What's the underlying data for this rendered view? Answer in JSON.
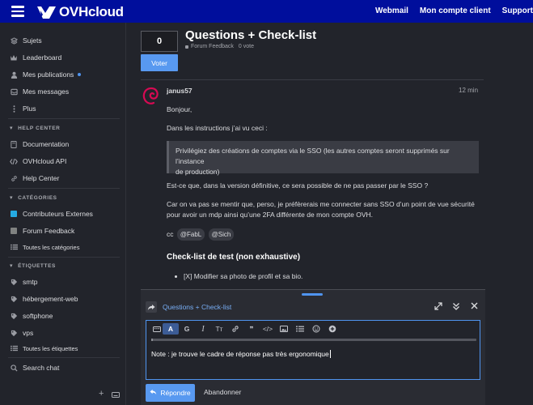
{
  "header": {
    "brand": "OVHcloud",
    "nav": [
      "Webmail",
      "Mon compte client",
      "Support"
    ]
  },
  "sidebar": {
    "main": [
      {
        "label": "Sujets",
        "icon": "layers-icon"
      },
      {
        "label": "Leaderboard",
        "icon": "crown-icon"
      },
      {
        "label": "Mes publications",
        "icon": "user-icon",
        "badge": true
      },
      {
        "label": "Mes messages",
        "icon": "inbox-icon"
      },
      {
        "label": "Plus",
        "icon": "more-vertical-icon"
      }
    ],
    "help_center": {
      "heading": "HELP CENTER",
      "items": [
        {
          "label": "Documentation",
          "icon": "book-icon"
        },
        {
          "label": "OVHcloud API",
          "icon": "code-icon"
        },
        {
          "label": "Help Center",
          "icon": "link-icon"
        }
      ]
    },
    "categories": {
      "heading": "CATÉGORIES",
      "items": [
        {
          "label": "Contributeurs Externes",
          "color": "#25aae2"
        },
        {
          "label": "Forum Feedback",
          "color": "#808281"
        }
      ],
      "all_label": "Toutes les catégories"
    },
    "tags": {
      "heading": "ÉTIQUETTES",
      "items": [
        "smtp",
        "hébergement-web",
        "softphone",
        "vps"
      ],
      "all_label": "Toutes les étiquettes"
    },
    "search_chat": "Search chat"
  },
  "topic": {
    "vote_count": "0",
    "vote_button": "Voter",
    "title": "Questions + Check-list",
    "category": "Forum Feedback",
    "votes_meta": "0 vote"
  },
  "post": {
    "author": "janus57",
    "time": "12 min",
    "p1": "Bonjour,",
    "p2": "Dans les instructions j’ai vu ceci :",
    "quote_line1": "Privilégiez des créations de comptes via le SSO (les autres comptes seront supprimés sur l’instance",
    "quote_line2": "de production)",
    "p3": "Est-ce que, dans la version définitive, ce sera possible de ne pas passer par le SSO ?",
    "p4_line1": "Car on va pas se mentir que, perso, je préfèrerais me connecter sans SSO d’un point de vue sécurité",
    "p4_line2": "pour avoir un mdp ainsi qu’une 2FA différente de mon compte OVH.",
    "cc": "cc",
    "mention1": "@FabL",
    "mention2": "@Sich",
    "heading": "Check-list de test (non exhaustive)",
    "list_item": "[X] Modifier sa photo de profil et sa bio."
  },
  "composer": {
    "reply_to": "Questions + Check-list",
    "toolbar": [
      "A",
      "G",
      "I",
      "Tт",
      "🔗",
      "❞",
      "</>",
      "▣",
      "☰",
      "☺",
      "+"
    ],
    "text": "Note : je trouve le cadre de réponse pas très ergonomique",
    "reply_button": "Répondre",
    "cancel_button": "Abandonner"
  },
  "colors": {
    "header_bg": "#000e9c",
    "accent": "#5899f0",
    "page_bg": "#22242b"
  }
}
